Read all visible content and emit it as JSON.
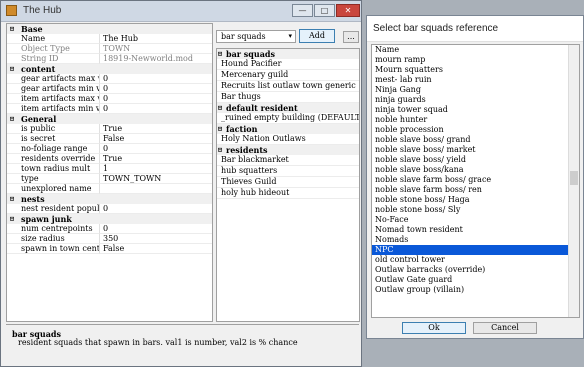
{
  "main_window": {
    "title": "The Hub",
    "controls": {
      "minimize": "—",
      "maximize": "□",
      "close": "✕"
    }
  },
  "property_grid": [
    {
      "category": "Base",
      "toggle": "⊟",
      "rows": [
        {
          "name": "Name",
          "value": "The Hub",
          "grey": false
        },
        {
          "name": "Object Type",
          "value": "TOWN",
          "grey": true
        },
        {
          "name": "String ID",
          "value": "18919-Newworld.mod",
          "grey": true
        }
      ]
    },
    {
      "category": "content",
      "toggle": "⊟",
      "rows": [
        {
          "name": "gear artifacts max value",
          "value": "0",
          "grey": false
        },
        {
          "name": "gear artifacts min value",
          "value": "0",
          "grey": false
        },
        {
          "name": "item artifacts max value",
          "value": "0",
          "grey": false
        },
        {
          "name": "item artifacts min value",
          "value": "0",
          "grey": false
        }
      ]
    },
    {
      "category": "General",
      "toggle": "⊟",
      "rows": [
        {
          "name": "is public",
          "value": "True",
          "grey": false
        },
        {
          "name": "is secret",
          "value": "False",
          "grey": false
        },
        {
          "name": "no-foliage range",
          "value": "0",
          "grey": false
        },
        {
          "name": "residents override",
          "value": "True",
          "grey": false
        },
        {
          "name": "town radius mult",
          "value": "1",
          "grey": false
        },
        {
          "name": "type",
          "value": "TOWN_TOWN",
          "grey": false
        },
        {
          "name": "unexplored name",
          "value": "",
          "grey": false
        }
      ]
    },
    {
      "category": "nests",
      "toggle": "⊟",
      "rows": [
        {
          "name": "nest resident population",
          "value": "0",
          "grey": false
        }
      ]
    },
    {
      "category": "spawn junk",
      "toggle": "⊟",
      "rows": [
        {
          "name": "num centrepoints",
          "value": "0",
          "grey": false
        },
        {
          "name": "size radius",
          "value": "350",
          "grey": false
        },
        {
          "name": "spawn in town centre",
          "value": "False",
          "grey": false
        }
      ]
    }
  ],
  "ref_controls": {
    "combo_value": "bar squads",
    "combo_arrow": "▾",
    "add_label": "Add",
    "more_label": "..."
  },
  "ref_list": [
    {
      "category": "bar squads",
      "toggle": "⊟",
      "items": [
        "Hound Pacifier",
        "Mercenary guild",
        "Recruits list outlaw town generic",
        "Bar thugs"
      ]
    },
    {
      "category": "default resident",
      "toggle": "⊟",
      "items": [
        "_ruined empty building (DEFAULT)"
      ]
    },
    {
      "category": "faction",
      "toggle": "⊟",
      "items": [
        "Holy Nation Outlaws"
      ]
    },
    {
      "category": "residents",
      "toggle": "⊟",
      "items": [
        "Bar blackmarket",
        "hub squatters",
        "Thieves Guild",
        "holy hub hideout"
      ]
    }
  ],
  "description": {
    "title": "bar squads",
    "text": "resident squads that spawn in bars. val1 is number, val2 is % chance"
  },
  "dialog": {
    "title": "Select bar squads reference",
    "selected_index": 21,
    "items": [
      "Name",
      "mourn ramp",
      "Mourn squatters",
      "mest- lab ruin",
      "Ninja Gang",
      "ninja guards",
      "ninja tower squad",
      "noble hunter",
      "noble procession",
      "noble slave boss/ grand",
      "noble slave boss/ market",
      "noble slave boss/ yield",
      "noble slave boss/kana",
      "noble slave farm boss/ grace",
      "noble slave farm boss/ ren",
      "noble stone boss/ Haga",
      "noble stone boss/ Sly",
      "No-Face",
      "Nomad town resident",
      "Nomads",
      "NPC",
      "old control tower",
      "Outlaw barracks (override)",
      "Outlaw Gate guard",
      "Outlaw group (villain)"
    ],
    "ok_label": "Ok",
    "cancel_label": "Cancel"
  },
  "colors": {
    "selection": "#0a58d8",
    "close_button": "#c9463d",
    "title_bar": "#cfd8e4"
  }
}
